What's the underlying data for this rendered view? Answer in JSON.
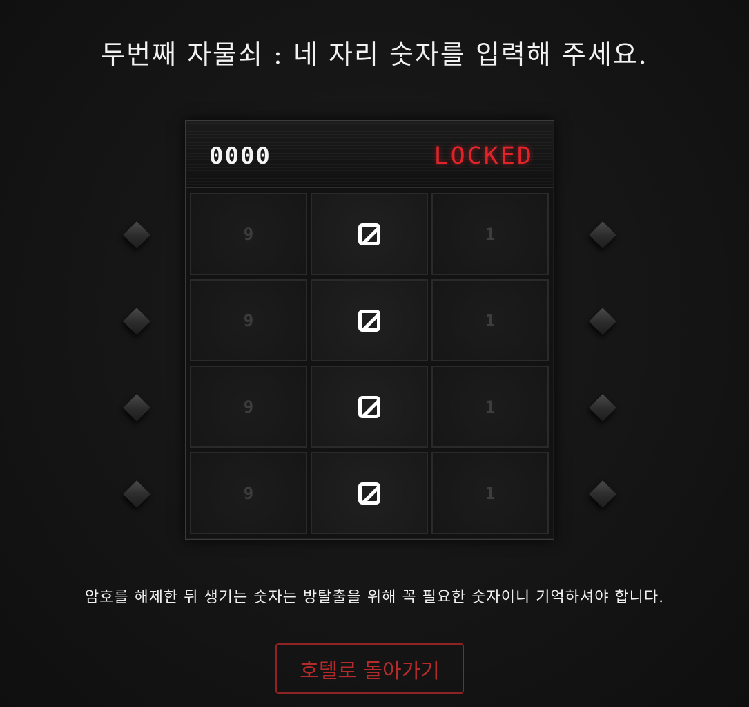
{
  "title": "두번째 자물쇠 : 네 자리 숫자를 입력해 주세요.",
  "display": {
    "code": "0000",
    "status": "LOCKED",
    "status_color": "#e0242a"
  },
  "wheels": [
    {
      "prev": "9",
      "current": "0",
      "next": "1"
    },
    {
      "prev": "9",
      "current": "0",
      "next": "1"
    },
    {
      "prev": "9",
      "current": "0",
      "next": "1"
    },
    {
      "prev": "9",
      "current": "0",
      "next": "1"
    }
  ],
  "controls": {
    "left_icon": "diamond-arrow-icon",
    "right_icon": "diamond-arrow-icon"
  },
  "notice": "암호를 해제한 뒤 생기는 숫자는 방탈출을 위해 꼭 필요한 숫자이니 기억하셔야 합니다.",
  "back_button": {
    "label": "호텔로 돌아가기",
    "color": "#b52a2a"
  }
}
